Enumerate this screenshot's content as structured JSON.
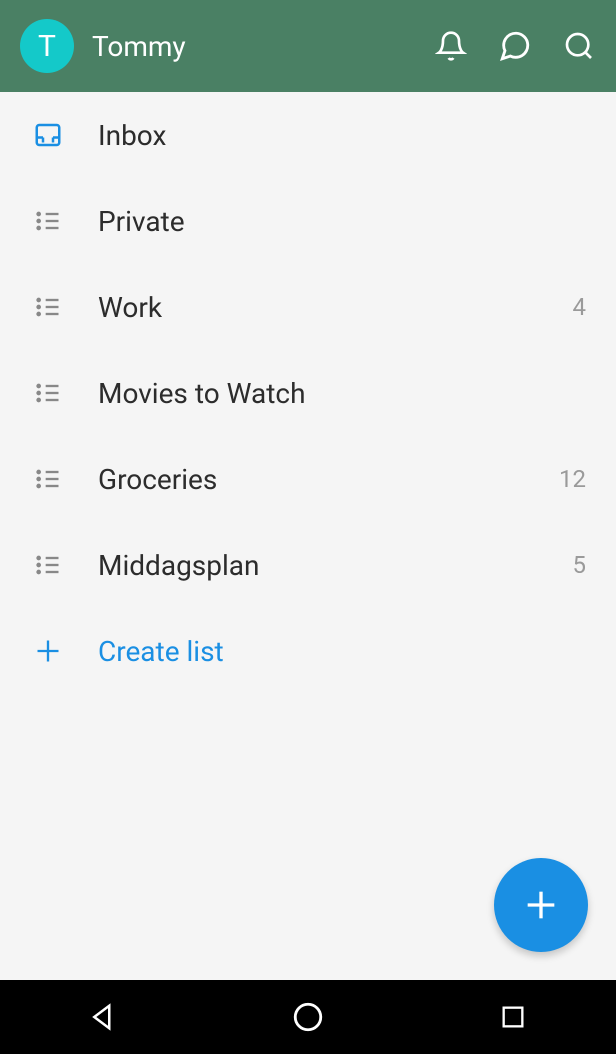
{
  "header": {
    "avatar_initial": "T",
    "username": "Tommy"
  },
  "lists": [
    {
      "label": "Inbox",
      "count": null,
      "icon": "inbox"
    },
    {
      "label": "Private",
      "count": null,
      "icon": "list"
    },
    {
      "label": "Work",
      "count": "4",
      "icon": "list"
    },
    {
      "label": "Movies to Watch",
      "count": null,
      "icon": "list"
    },
    {
      "label": "Groceries",
      "count": "12",
      "icon": "list"
    },
    {
      "label": "Middagsplan",
      "count": "5",
      "icon": "list"
    }
  ],
  "create_list_label": "Create list"
}
